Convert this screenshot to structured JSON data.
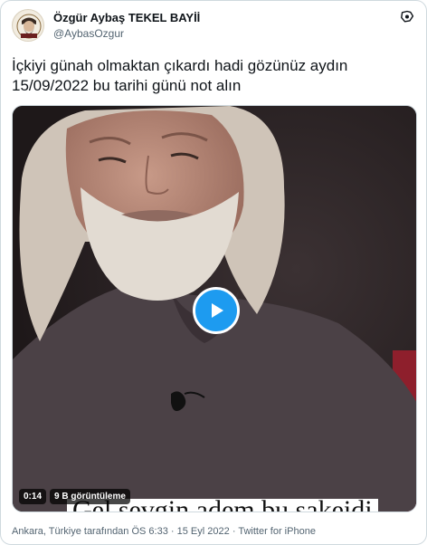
{
  "author": {
    "display_name": "Özgür Aybaş TEKEL BAYİİ",
    "handle": "@AybasOzgur",
    "avatar_icon": "profile-avatar-icon"
  },
  "tweet": {
    "text_line1": "İçkiyi günah olmaktan çıkardı hadi gözünüz aydın",
    "text_line2": "15/09/2022 bu tarihi günü not alın"
  },
  "media": {
    "type": "video",
    "duration": "0:14",
    "views": "9 B görüntüleme",
    "subtitle": "Gel sevgin adem bu sakeidi",
    "play_icon": "play-icon",
    "colors": {
      "play_button": "#1d9bf0",
      "background": "#2a2324"
    }
  },
  "meta": {
    "location": "Ankara, Türkiye tarafından",
    "time": "ÖS 6:33",
    "date": "15 Eyl 2022",
    "source": "Twitter for iPhone",
    "separator": "·"
  },
  "colors": {
    "text_primary": "#0f1419",
    "text_secondary": "#536471",
    "border": "#cfd9de"
  }
}
